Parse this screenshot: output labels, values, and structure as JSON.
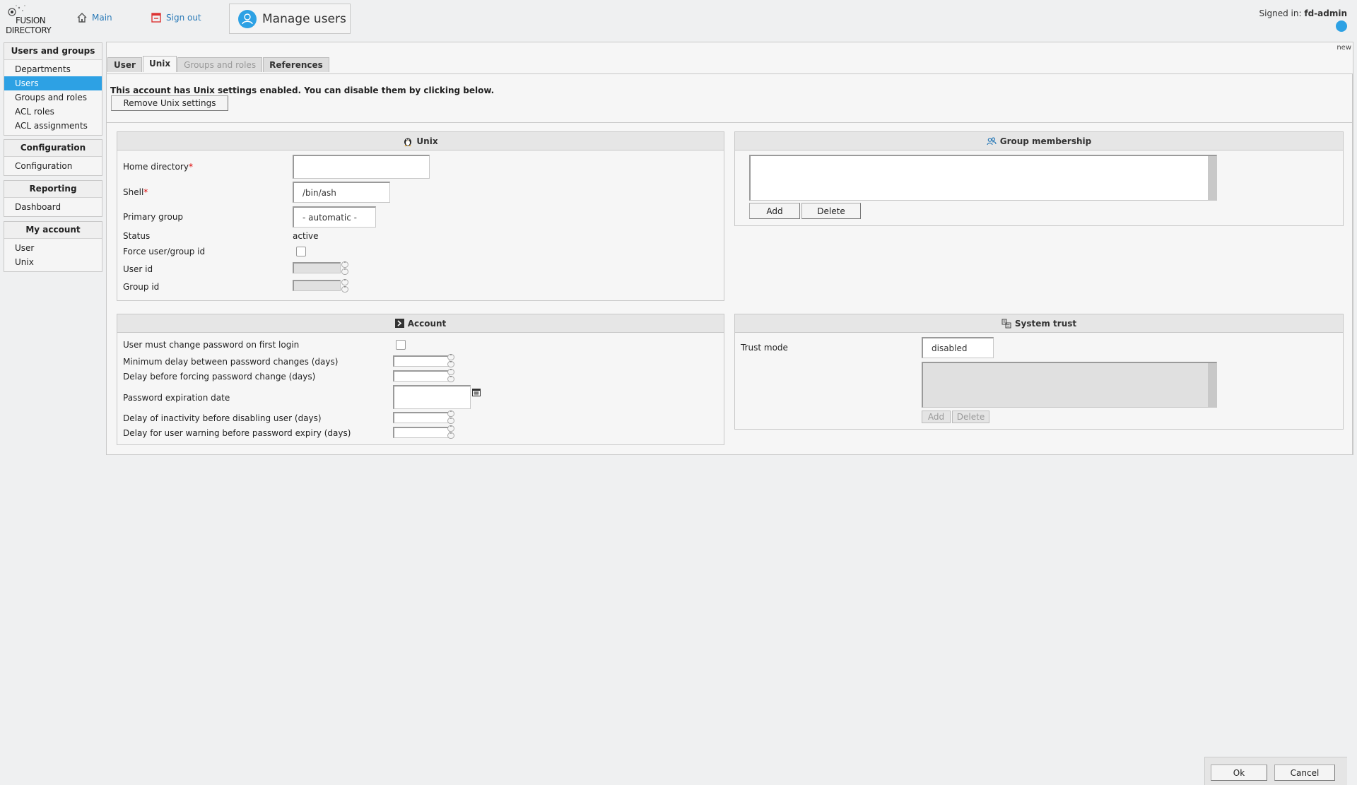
{
  "app": {
    "logo_line1": "FUSION",
    "logo_line2": "DIRECTORY"
  },
  "header": {
    "main_link": "Main",
    "signout_link": "Sign out",
    "page_title": "Manage users",
    "signed_in_label": "Signed in:",
    "signed_in_user": "fd-admin"
  },
  "sidebar": {
    "groups": [
      {
        "title": "Users and groups",
        "items": [
          "Departments",
          "Users",
          "Groups and roles",
          "ACL roles",
          "ACL assignments"
        ]
      },
      {
        "title": "Configuration",
        "items": [
          "Configuration"
        ]
      },
      {
        "title": "Reporting",
        "items": [
          "Dashboard"
        ]
      },
      {
        "title": "My account",
        "items": [
          "User",
          "Unix"
        ]
      }
    ],
    "active_item": "Users"
  },
  "main": {
    "new_label": "new",
    "tabs": [
      {
        "label": "User",
        "state": "normal"
      },
      {
        "label": "Unix",
        "state": "active"
      },
      {
        "label": "Groups and roles",
        "state": "disabled"
      },
      {
        "label": "References",
        "state": "normal"
      }
    ],
    "notice": "This account has Unix settings enabled. You can disable them by clicking below.",
    "remove_button": "Remove Unix settings"
  },
  "unix": {
    "title": "Unix",
    "home_label": "Home directory",
    "home_value": "",
    "shell_label": "Shell",
    "shell_value": "/bin/ash",
    "primary_group_label": "Primary group",
    "primary_group_value": "- automatic -",
    "status_label": "Status",
    "status_value": "active",
    "force_label": "Force user/group id",
    "force_checked": false,
    "uid_label": "User id",
    "gid_label": "Group id",
    "required_mark": "*"
  },
  "group_membership": {
    "title": "Group membership",
    "add": "Add",
    "delete": "Delete"
  },
  "account": {
    "title": "Account",
    "must_change_label": "User must change password on first login",
    "min_delay_label": "Minimum delay between password changes (days)",
    "force_change_label": "Delay before forcing password change (days)",
    "expiration_label": "Password expiration date",
    "inactivity_label": "Delay of inactivity before disabling user (days)",
    "warning_label": "Delay for user warning before password expiry (days)"
  },
  "system_trust": {
    "title": "System trust",
    "trust_mode_label": "Trust mode",
    "trust_mode_value": "disabled",
    "add": "Add",
    "delete": "Delete"
  },
  "footer": {
    "ok": "Ok",
    "cancel": "Cancel"
  },
  "colors": {
    "accent": "#2da1e4",
    "link": "#2a7ab8",
    "required": "#dd0000"
  },
  "icons": [
    "home-icon",
    "signout-icon",
    "user-icon",
    "tux-icon",
    "group-icon",
    "account-icon",
    "system-trust-icon",
    "calendar-icon"
  ]
}
